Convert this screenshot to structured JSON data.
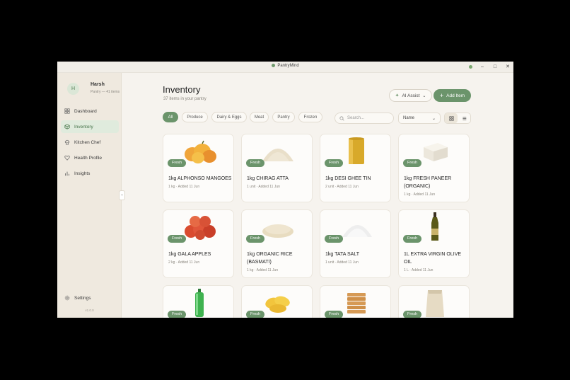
{
  "window": {
    "title": "PantryMind"
  },
  "user": {
    "initial": "H",
    "name": "Harsh",
    "subtitle": "Pantry — 41 items"
  },
  "sidebar": {
    "items": [
      {
        "label": "Dashboard",
        "icon": "grid-icon"
      },
      {
        "label": "Inventory",
        "icon": "box-icon",
        "active": true
      },
      {
        "label": "Kitchen Chef",
        "icon": "chef-hat-icon"
      },
      {
        "label": "Health Profile",
        "icon": "heart-icon"
      },
      {
        "label": "Insights",
        "icon": "bar-chart-icon"
      }
    ],
    "settings_label": "Settings",
    "version": "v1.0.0"
  },
  "header": {
    "title": "Inventory",
    "subtitle": "37 items in your pantry",
    "ai_assist_label": "AI Assist",
    "add_item_label": "Add Item"
  },
  "filters": {
    "chips": [
      "All",
      "Produce",
      "Dairy & Eggs",
      "Meat",
      "Pantry",
      "Frozen"
    ],
    "active": "All",
    "search_placeholder": "Search...",
    "sort_value": "Name"
  },
  "items": [
    {
      "name": "1kg ALPHONSO MANGOES",
      "meta": "1 kg · Added 11 Jun",
      "status": "Fresh",
      "image": "mangoes"
    },
    {
      "name": "1kg CHIRAG ATTA",
      "meta": "1 unit · Added 11 Jun",
      "status": "Fresh",
      "image": "flour"
    },
    {
      "name": "1kg DESI GHEE TIN",
      "meta": "2 unit · Added 11 Jun",
      "status": "Fresh",
      "image": "tin"
    },
    {
      "name": "1kg FRESH PANEER (ORGANIC)",
      "meta": "1 kg · Added 11 Jun",
      "status": "Fresh",
      "image": "paneer"
    },
    {
      "name": "1kg GALA APPLES",
      "meta": "2 kg · Added 11 Jun",
      "status": "Fresh",
      "image": "apples"
    },
    {
      "name": "1kg ORGANIC RICE (BASMATI)",
      "meta": "1 kg · Added 11 Jun",
      "status": "Fresh",
      "image": "rice"
    },
    {
      "name": "1kg TATA SALT",
      "meta": "1 unit · Added 11 Jun",
      "status": "Fresh",
      "image": "salt"
    },
    {
      "name": "1L EXTRA VIRGIN OLIVE OIL",
      "meta": "1 L · Added 11 Jun",
      "status": "Fresh",
      "image": "olive-oil"
    },
    {
      "name": "",
      "meta": "",
      "status": "Fresh",
      "image": "green-bottle"
    },
    {
      "name": "",
      "meta": "",
      "status": "Fresh",
      "image": "chips"
    },
    {
      "name": "",
      "meta": "",
      "status": "Fresh",
      "image": "biscuits"
    },
    {
      "name": "",
      "meta": "",
      "status": "Fresh",
      "image": "sack"
    }
  ],
  "colors": {
    "accent": "#6b946b",
    "background": "#f6f3ee",
    "sidebar": "#efe9df"
  }
}
